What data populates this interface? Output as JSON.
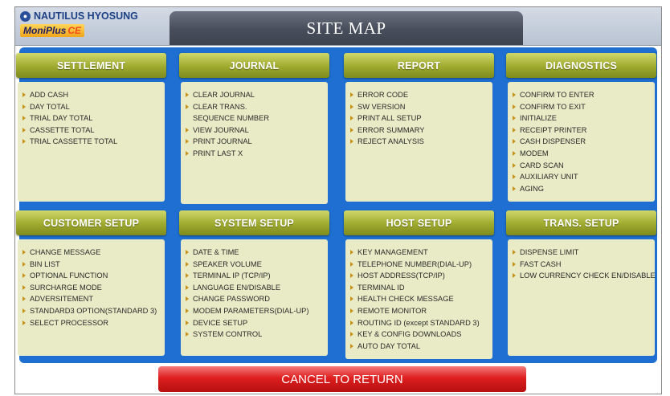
{
  "brand": {
    "company": "NAUTILUS HYOSUNG",
    "product": "MoniPlus",
    "edition": "CE"
  },
  "title": "SITE MAP",
  "cards": [
    {
      "title": "SETTLEMENT",
      "items": [
        "ADD CASH",
        "DAY TOTAL",
        "TRIAL DAY TOTAL",
        "CASSETTE TOTAL",
        "TRIAL CASSETTE TOTAL"
      ]
    },
    {
      "title": "JOURNAL",
      "items": [
        "CLEAR JOURNAL",
        "CLEAR TRANS.",
        "SEQUENCE NUMBER",
        "VIEW JOURNAL",
        "PRINT JOURNAL",
        "PRINT LAST X"
      ]
    },
    {
      "title": "REPORT",
      "items": [
        "ERROR CODE",
        "SW VERSION",
        "PRINT ALL SETUP",
        "ERROR SUMMARY",
        "REJECT ANALYSIS"
      ]
    },
    {
      "title": "DIAGNOSTICS",
      "items": [
        "CONFIRM TO ENTER",
        "CONFIRM TO EXIT",
        "INITIALIZE",
        "RECEIPT PRINTER",
        "CASH DISPENSER",
        "MODEM",
        "CARD SCAN",
        "AUXILIARY UNIT",
        "AGING"
      ]
    },
    {
      "title": "CUSTOMER SETUP",
      "items": [
        "CHANGE MESSAGE",
        "BIN LIST",
        "OPTIONAL FUNCTION",
        "SURCHARGE MODE",
        "ADVERSITEMENT",
        "STANDARD3 OPTION(STANDARD 3)",
        "SELECT PROCESSOR"
      ]
    },
    {
      "title": "SYSTEM SETUP",
      "items": [
        "DATE & TIME",
        "SPEAKER VOLUME",
        "TERMINAL IP (TCP/IP)",
        "LANGUAGE EN/DISABLE",
        "CHANGE PASSWORD",
        "MODEM PARAMETERS(DIAL-UP)",
        "DEVICE SETUP",
        "SYSTEM CONTROL"
      ]
    },
    {
      "title": "HOST SETUP",
      "items": [
        "KEY MANAGEMENT",
        "TELEPHONE NUMBER(DIAL-UP)",
        "HOST ADDRESS(TCP/IP)",
        "TERMINAL ID",
        "HEALTH CHECK MESSAGE",
        "REMOTE MONITOR",
        "ROUTING ID (except STANDARD 3)",
        "KEY & CONFIG DOWNLOADS",
        "AUTO DAY TOTAL"
      ]
    },
    {
      "title": "TRANS. SETUP",
      "items": [
        "DISPENSE LIMIT",
        "FAST CASH",
        "LOW CURRENCY CHECK EN/DISABLE"
      ]
    }
  ],
  "cancel_label": "CANCEL TO RETURN",
  "colors": {
    "panel": "#1e6fd1",
    "card_header": "#9eaa2e",
    "card_body": "#e8ebc6",
    "cancel": "#de1f1f"
  }
}
